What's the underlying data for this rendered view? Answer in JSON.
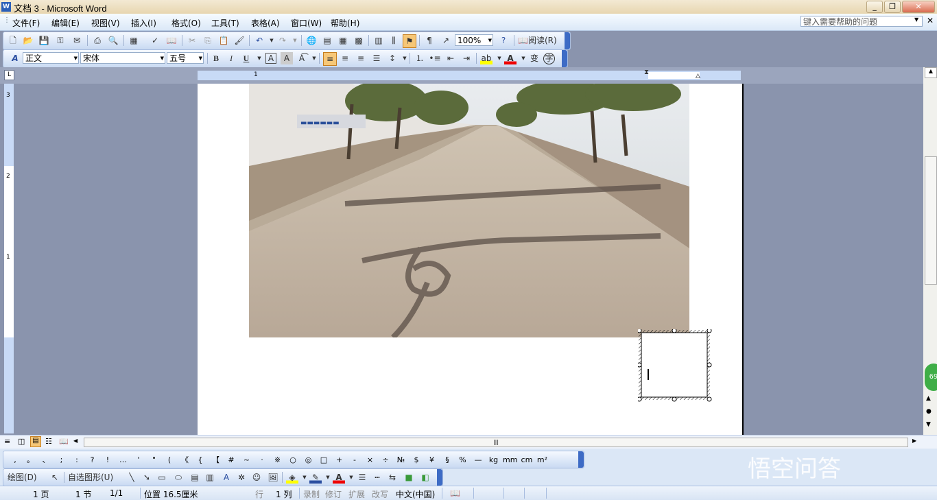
{
  "window": {
    "title": "文档 3 - Microsoft Word",
    "icon": "word-doc-icon"
  },
  "menu": {
    "items": [
      "文件(F)",
      "编辑(E)",
      "视图(V)",
      "插入(I)",
      "格式(O)",
      "工具(T)",
      "表格(A)",
      "窗口(W)",
      "帮助(H)"
    ],
    "help_placeholder": "键入需要帮助的问题"
  },
  "standard_toolbar": {
    "zoom": "100%",
    "read_label": "阅读(R)"
  },
  "format_toolbar": {
    "style": "正文",
    "font": "宋体",
    "size": "五号",
    "bold": "B",
    "italic": "I",
    "underline": "U"
  },
  "ruler": {
    "h_mark": "1",
    "v_marks": [
      "3",
      "2",
      "1"
    ]
  },
  "symbol_bar": {
    "symbols": [
      ",",
      "。",
      "、",
      ";",
      ":",
      "?",
      "!",
      "…",
      "'",
      "\"",
      "(",
      "《",
      "{",
      "【",
      "#",
      "~",
      "·",
      "※",
      "○",
      "◎",
      "□",
      "+",
      "-",
      "×",
      "÷",
      "№",
      "$",
      "¥",
      "§",
      "%",
      "—",
      "kg",
      "mm",
      "cm",
      "m²"
    ]
  },
  "draw_bar": {
    "draw_label": "绘图(D)",
    "autoshape_label": "自选图形(U)"
  },
  "status": {
    "page": "1 页",
    "section": "1 节",
    "pages": "1/1",
    "position": "位置 16.5厘米",
    "line": "行",
    "col": "1 列",
    "rec": "录制",
    "trk": "修订",
    "ext": "扩展",
    "ovr": "改写",
    "lang": "中文(中国)"
  },
  "overlay": {
    "watermark": "悟空问答",
    "badge": "69"
  },
  "colors": {
    "toolbar_top": "#f5f9ff",
    "toolbar_bottom": "#c9daf2",
    "doc_background": "#8a94ad",
    "grip": "#3d6bc5",
    "title_bg": "#e7d6b0"
  }
}
